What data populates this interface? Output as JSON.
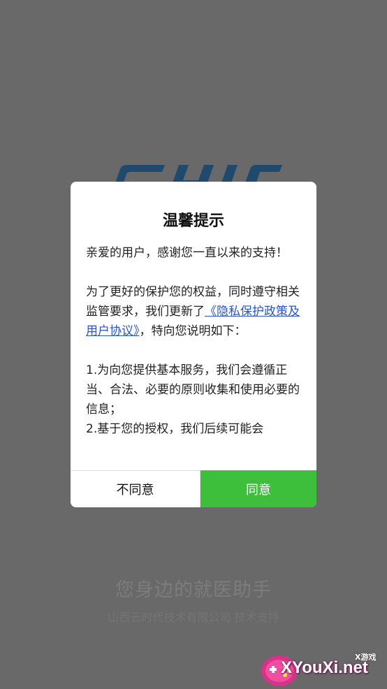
{
  "dialog": {
    "title": "温馨提示",
    "greeting": "亲爱的用户，感谢您一直以来的支持！",
    "para2_before": "为了更好的保护您的权益，同时遵守相关监管要求，我们更新了",
    "para2_link": "《隐私保护政策及用户协议》",
    "para2_after": "，特向您说明如下：",
    "item1": "1.为向您提供基本服务，我们会遵循正当、合法、必要的原则收集和使用必要的信息；",
    "item2": "2.基于您的授权，我们后续可能会",
    "disagree_label": "不同意",
    "agree_label": "同意"
  },
  "background": {
    "tagline": "您身边的就医助手",
    "company": "山西云时代技术有限公司 技术支持"
  },
  "watermark": {
    "brand": "XYouXi.net",
    "sub": "X游戏"
  },
  "colors": {
    "overlay_bg": "#696969",
    "agree_button": "#3dbf3c",
    "link": "#2a55c8",
    "logo": "#1f4a6e"
  },
  "icons": {
    "watermark_logo": "gamepad-icon"
  }
}
